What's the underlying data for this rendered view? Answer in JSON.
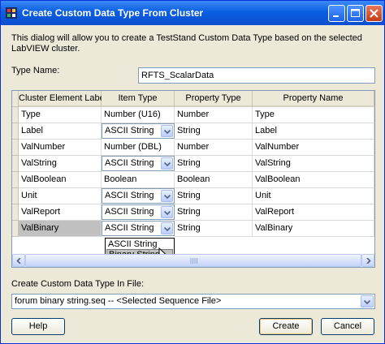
{
  "window": {
    "title": "Create Custom Data Type From Cluster",
    "title_bar_color": "#0a5fe0",
    "controls": [
      "minimize-icon",
      "maximize-icon",
      "close-icon"
    ]
  },
  "description": "This dialog will allow you to create a TestStand Custom Data Type based on the selected LabVIEW cluster.",
  "type_name": {
    "label": "Type Name:",
    "value": "RFTS_ScalarData"
  },
  "grid": {
    "columns": [
      "Cluster Element Label",
      "Item Type",
      "Property Type",
      "Property Name"
    ],
    "rows": [
      {
        "label": "Type",
        "item_type": "Number (U16)",
        "has_dropdown": false,
        "property_type": "Number",
        "property_name": "Type"
      },
      {
        "label": "Label",
        "item_type": "ASCII String",
        "has_dropdown": true,
        "property_type": "String",
        "property_name": "Label"
      },
      {
        "label": "ValNumber",
        "item_type": "Number (DBL)",
        "has_dropdown": false,
        "property_type": "Number",
        "property_name": "ValNumber"
      },
      {
        "label": "ValString",
        "item_type": "ASCII String",
        "has_dropdown": true,
        "property_type": "String",
        "property_name": "ValString"
      },
      {
        "label": "ValBoolean",
        "item_type": "Boolean",
        "has_dropdown": false,
        "property_type": "Boolean",
        "property_name": "ValBoolean"
      },
      {
        "label": "Unit",
        "item_type": "ASCII String",
        "has_dropdown": true,
        "property_type": "String",
        "property_name": "Unit"
      },
      {
        "label": "ValReport",
        "item_type": "ASCII String",
        "has_dropdown": true,
        "property_type": "String",
        "property_name": "ValReport"
      },
      {
        "label": "ValBinary",
        "item_type": "ASCII String",
        "has_dropdown": true,
        "property_type": "String",
        "property_name": "ValBinary",
        "selected": true
      }
    ],
    "open_dropdown": {
      "row": "ValBinary",
      "options": [
        "ASCII String",
        "Binary String"
      ],
      "highlighted": "Binary String"
    }
  },
  "file": {
    "label": "Create Custom Data Type In File:",
    "value": "forum binary string.seq  -- <Selected Sequence File>"
  },
  "buttons": {
    "help": "Help",
    "create": "Create",
    "cancel": "Cancel"
  }
}
